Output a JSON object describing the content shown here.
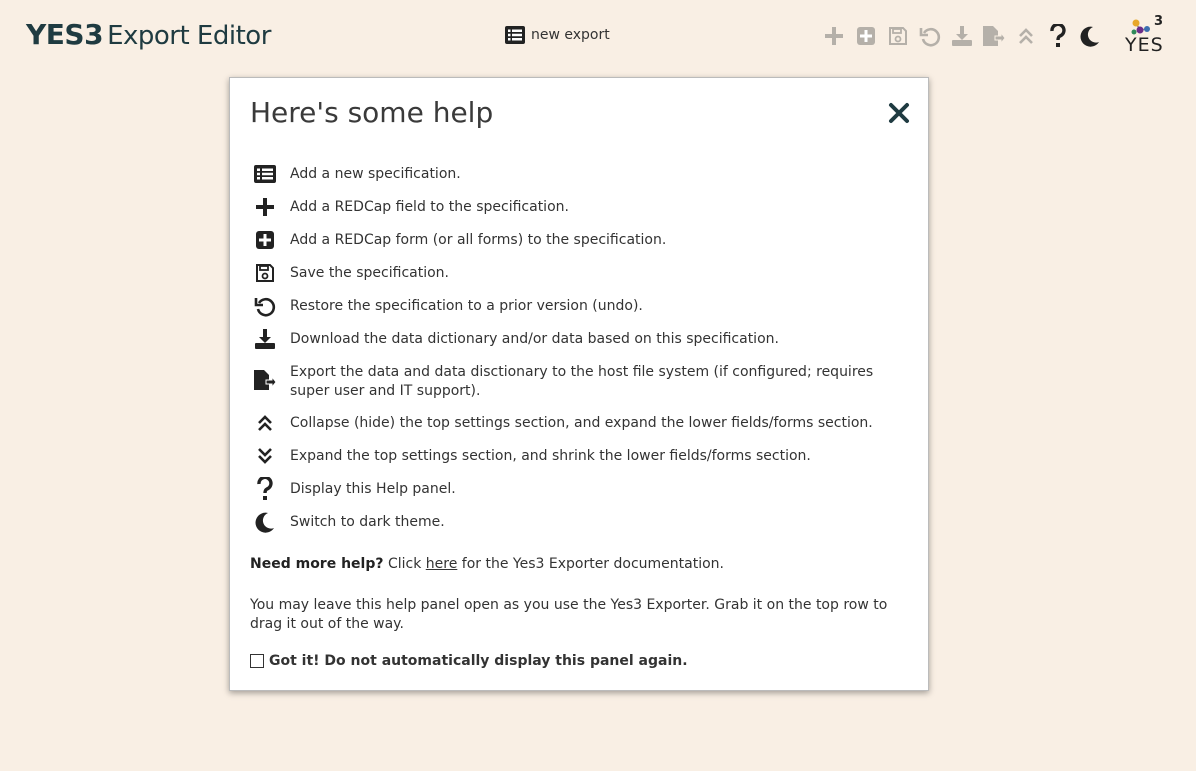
{
  "app": {
    "title_brand": "YES3",
    "title_rest": "Export Editor"
  },
  "header": {
    "new_export_label": "new export",
    "toolbar_icons": [
      "plus-icon",
      "plus-square-icon",
      "save-icon",
      "undo-icon",
      "download-icon",
      "export-file-icon",
      "collapse-icon",
      "help-icon",
      "moon-icon"
    ],
    "logo_sup": "3",
    "logo_text": "YES"
  },
  "help_panel": {
    "title": "Here's some help",
    "items": [
      {
        "icon": "list-icon",
        "text": "Add a new specification."
      },
      {
        "icon": "plus-icon",
        "text": "Add a REDCap field to the specification."
      },
      {
        "icon": "plus-square-icon",
        "text": "Add a REDCap form (or all forms) to the specification."
      },
      {
        "icon": "save-icon",
        "text": "Save the specification."
      },
      {
        "icon": "undo-icon",
        "text": "Restore the specification to a prior version (undo)."
      },
      {
        "icon": "download-icon",
        "text": "Download the data dictionary and/or data based on this specification."
      },
      {
        "icon": "export-file-icon",
        "text": "Export the data and data disctionary to the host file system (if configured; requires super user and IT support)."
      },
      {
        "icon": "collapse-icon",
        "text": "Collapse (hide) the top settings section, and expand the lower fields/forms section."
      },
      {
        "icon": "expand-icon",
        "text": "Expand the top settings section, and shrink the lower fields/forms section."
      },
      {
        "icon": "help-icon",
        "text": "Display this Help panel."
      },
      {
        "icon": "moon-icon",
        "text": "Switch to dark theme."
      }
    ],
    "more_help_bold": "Need more help?",
    "more_help_pre": " Click ",
    "more_help_link": "here",
    "more_help_post": " for the Yes3 Exporter documentation.",
    "leave_open_text": "You may leave this help panel open as you use the Yes3 Exporter. Grab it on the top row to drag it out of the way.",
    "gotit_label": "Got it! Do not automatically display this panel again.",
    "gotit_checked": false
  },
  "colors": {
    "background": "#f9efe4",
    "brand": "#1f3b41",
    "icon_disabled": "#b5b0a9",
    "icon_active": "#222222"
  }
}
